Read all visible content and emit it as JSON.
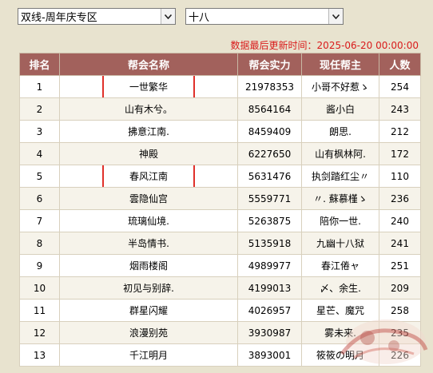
{
  "filters": {
    "server": "双线-周年庆专区",
    "region": "十八"
  },
  "update_text": "数据最后更新时间：2025-06-20 00:00:00",
  "columns": [
    "排名",
    "帮会名称",
    "帮会实力",
    "现任帮主",
    "人数"
  ],
  "rows": [
    {
      "rank": "1",
      "name": "一世繁华",
      "power": "21978353",
      "leader": "小哥不好惹ゝ",
      "members": "254",
      "highlight": true
    },
    {
      "rank": "2",
      "name": "山有木兮。",
      "power": "8564164",
      "leader": "酱小白",
      "members": "243",
      "highlight": false
    },
    {
      "rank": "3",
      "name": "拂意江南.",
      "power": "8459409",
      "leader": "朗思.",
      "members": "212",
      "highlight": false
    },
    {
      "rank": "4",
      "name": "神殿",
      "power": "6227650",
      "leader": "山有枫林阿.",
      "members": "172",
      "highlight": false
    },
    {
      "rank": "5",
      "name": "春风江南",
      "power": "5631476",
      "leader": "执剑踏红尘〃",
      "members": "110",
      "highlight": true
    },
    {
      "rank": "6",
      "name": "雲隐仙宫",
      "power": "5559771",
      "leader": "〃. 蘇慕槿ゝ",
      "members": "236",
      "highlight": false
    },
    {
      "rank": "7",
      "name": "琉璃仙境.",
      "power": "5263875",
      "leader": "陪你一世.",
      "members": "240",
      "highlight": false
    },
    {
      "rank": "8",
      "name": "半岛情书.",
      "power": "5135918",
      "leader": "九幽十八狱",
      "members": "241",
      "highlight": false
    },
    {
      "rank": "9",
      "name": "烟雨楼阁",
      "power": "4989977",
      "leader": "春江倦ャ",
      "members": "251",
      "highlight": false
    },
    {
      "rank": "10",
      "name": "初见与别辞.",
      "power": "4199013",
      "leader": "〆、余生.",
      "members": "209",
      "highlight": false
    },
    {
      "rank": "11",
      "name": "群星闪耀",
      "power": "4026957",
      "leader": "星芒、魔咒",
      "members": "258",
      "highlight": false
    },
    {
      "rank": "12",
      "name": "浪漫别苑",
      "power": "3930987",
      "leader": "雾未来.",
      "members": "235",
      "highlight": false
    },
    {
      "rank": "13",
      "name": "千江明月",
      "power": "3893001",
      "leader": "筱筱の明月",
      "members": "226",
      "highlight": false
    }
  ],
  "icons": {
    "dropdown": "chevron-down-icon",
    "watermark": "game-logo-watermark"
  },
  "colors": {
    "header_bg": "#a2615c",
    "highlight_border": "#e0302a",
    "update_text": "#d91b1b"
  }
}
